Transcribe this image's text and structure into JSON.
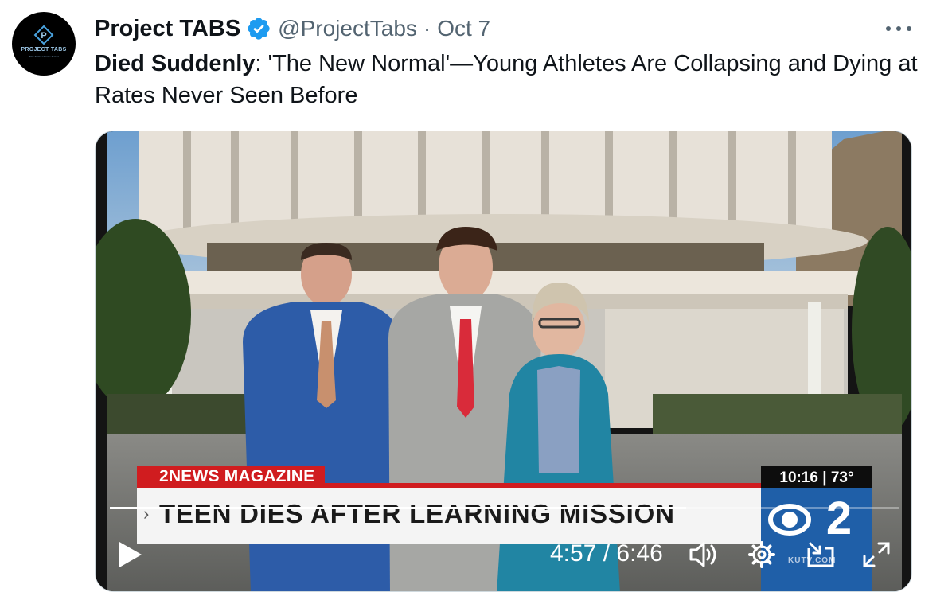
{
  "author": {
    "name": "Project TABS",
    "handle": "@ProjectTabs",
    "separator": "·",
    "date": "Oct 7",
    "avatar_brand": "PROJECT TABS",
    "avatar_tagline": "Take Turtles Vaccine Tested",
    "avatar_initial": "P"
  },
  "tweet": {
    "bold_prefix": "Died Suddenly",
    "text": ":  'The New Normal'—Young Athletes Are Collapsing and Dying at Rates Never Seen Before"
  },
  "video": {
    "program_label": "2NEWS MAGAZINE",
    "headline": "TEEN DIES AFTER LEARNING MISSION",
    "chevron": "›",
    "time_temp": "10:16 | 73°",
    "network_logo": "2",
    "website": "KUTV.COM",
    "current_time": "4:57",
    "duration": "6:46",
    "time_separator": " / ",
    "progress": 0.73
  },
  "icons": {
    "verified": "verified-badge-icon",
    "more": "more-dots-icon",
    "play": "play-icon",
    "volume": "volume-icon",
    "settings": "gear-icon",
    "minimize": "minimize-player-icon",
    "fullscreen": "fullscreen-icon"
  },
  "colors": {
    "verified_blue": "#1d9bf0",
    "text_primary": "#0f1419",
    "text_secondary": "#536471",
    "news_red": "#d01c1f",
    "cbs_blue": "#1f5fa8"
  }
}
